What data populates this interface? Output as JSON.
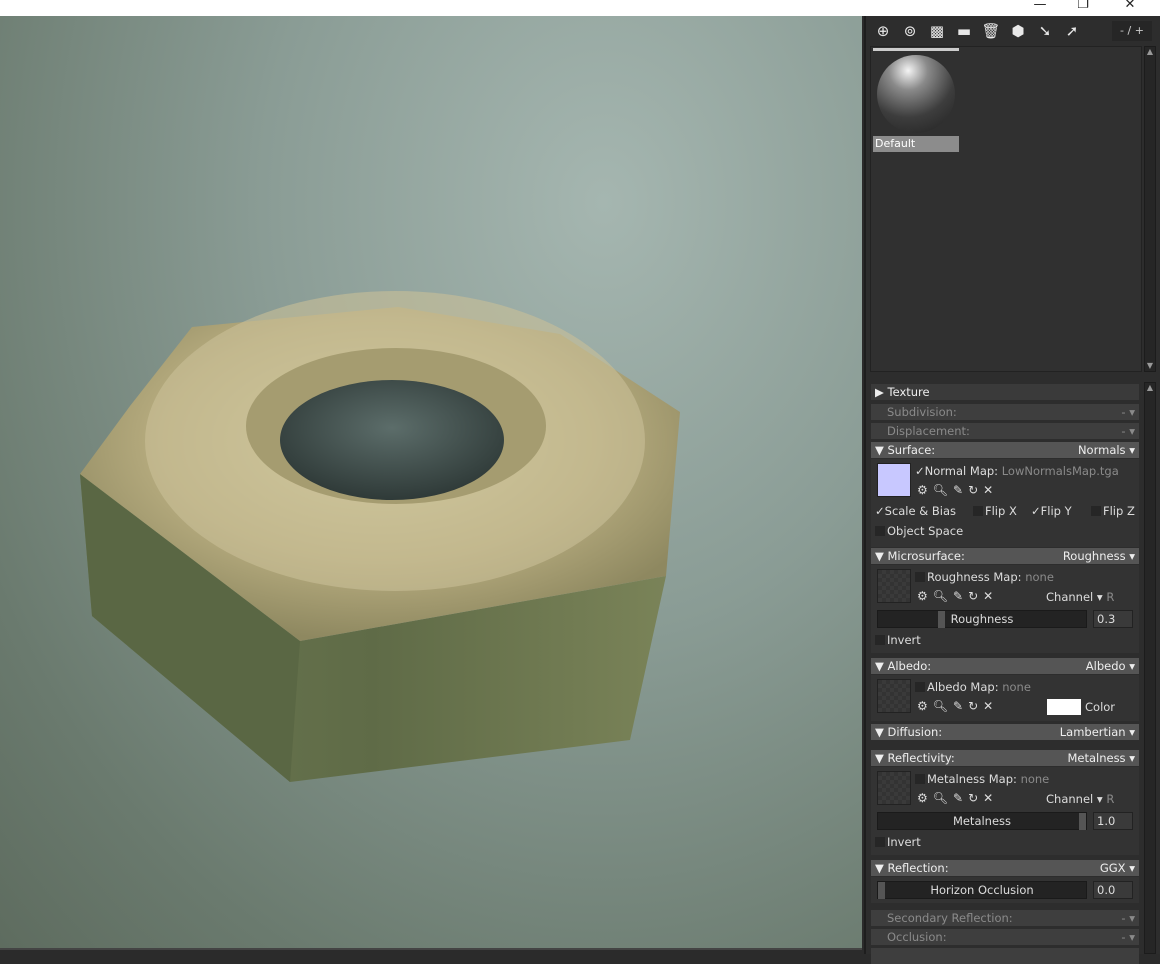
{
  "window": {
    "minimize": "—",
    "restore": "❐",
    "close": "✕"
  },
  "toolbar": {
    "icons": [
      "add-material-icon",
      "duplicate-material-icon",
      "checker-icon",
      "folder-icon",
      "trash-icon",
      "assign-icon",
      "import-icon",
      "export-icon"
    ],
    "glyphs": [
      "⊕",
      "⊚",
      "▩",
      "▬",
      "🗑",
      "⬢",
      "➘",
      "➚"
    ],
    "pager": "- / +"
  },
  "materials": [
    {
      "name": "Default"
    }
  ],
  "sections": {
    "texture": {
      "label": "Texture"
    },
    "subdivision": {
      "label": "Subdivision:",
      "value": "-"
    },
    "displacement": {
      "label": "Displacement:",
      "value": "-"
    },
    "surface": {
      "label": "Surface:",
      "value": "Normals",
      "map_label": "Normal Map:",
      "map_file": "LowNormalsMap.tga",
      "scale_bias": "Scale & Bias",
      "flip_x": "Flip X",
      "flip_y": "Flip Y",
      "flip_z": "Flip Z",
      "object_space": "Object Space",
      "swatch_color": "#c8c8ff"
    },
    "microsurface": {
      "label": "Microsurface:",
      "value": "Roughness",
      "map_label": "Roughness Map:",
      "map_file": "none",
      "channel_label": "Channel",
      "channel": "R",
      "slider_label": "Roughness",
      "slider_value": "0.3",
      "slider_fraction": 0.3,
      "invert": "Invert"
    },
    "albedo": {
      "label": "Albedo:",
      "value": "Albedo",
      "map_label": "Albedo Map:",
      "map_file": "none",
      "color_label": "Color",
      "color": "#ffffff"
    },
    "diffusion": {
      "label": "Diffusion:",
      "value": "Lambertian"
    },
    "reflectivity": {
      "label": "Reflectivity:",
      "value": "Metalness",
      "map_label": "Metalness Map:",
      "map_file": "none",
      "channel_label": "Channel",
      "channel": "R",
      "slider_label": "Metalness",
      "slider_value": "1.0",
      "slider_fraction": 1.0,
      "invert": "Invert"
    },
    "reflection": {
      "label": "Reflection:",
      "value": "GGX",
      "slider_label": "Horizon Occlusion",
      "slider_value": "0.0",
      "slider_fraction": 0.0
    },
    "secondary_reflection": {
      "label": "Secondary Reflection:",
      "value": "-"
    },
    "occlusion": {
      "label": "Occlusion:",
      "value": "-"
    }
  }
}
